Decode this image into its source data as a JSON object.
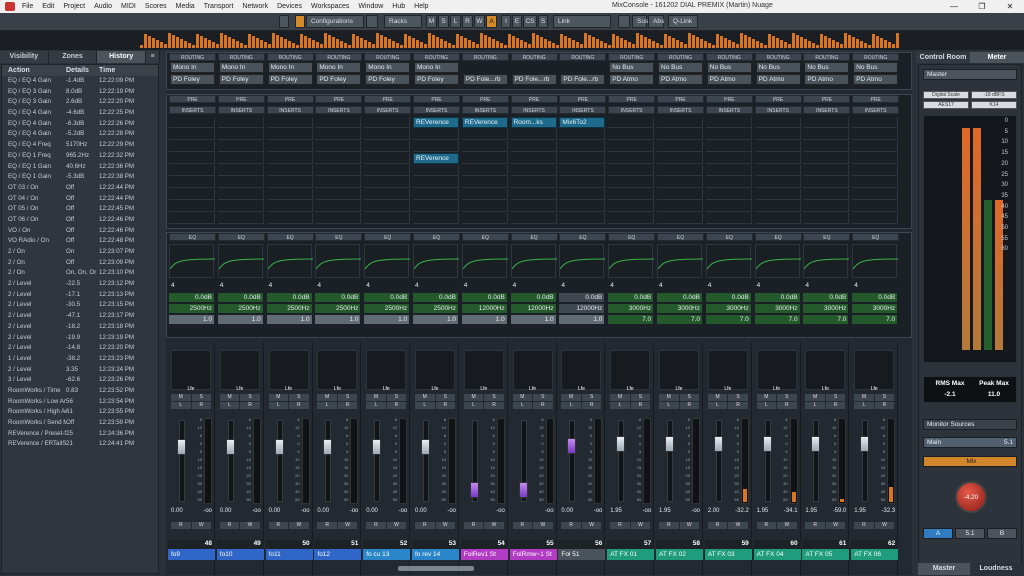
{
  "window": {
    "title": "MixConsole - 161202 DIAL PREMIX (Martin) Nuage",
    "controls": [
      "—",
      "❐",
      "✕"
    ],
    "menu": [
      "File",
      "Edit",
      "Project",
      "Audio",
      "MIDI",
      "Scores",
      "Media",
      "Transport",
      "Network",
      "Devices",
      "Workspaces",
      "Window",
      "Hub",
      "Help"
    ]
  },
  "toolbar": {
    "configurations": "Configurations",
    "racks": "Racks",
    "msrwa": [
      "M",
      "S",
      "L",
      "R",
      "W",
      "A"
    ],
    "iecs": [
      "I",
      "E",
      "CS",
      "S"
    ],
    "link": "Link",
    "sus_abs": [
      "Sus",
      "Abs"
    ],
    "qlink": "Q-Link"
  },
  "left_tabs": [
    "Visibility",
    "Zones",
    "History"
  ],
  "history": {
    "headers": [
      "Action",
      "Details",
      "Time"
    ],
    "rows": [
      [
        "EQ / EQ 4 Gain",
        "-1.4dB",
        "12:22:09 PM"
      ],
      [
        "EQ / EQ 3 Gain",
        "8.0dB",
        "12:22:19 PM"
      ],
      [
        "EQ / EQ 3 Gain",
        "2.6dB",
        "12:22:20 PM"
      ],
      [
        "EQ / EQ 4 Gain",
        "-4.6dB",
        "12:22:25 PM"
      ],
      [
        "EQ / EQ 4 Gain",
        "-6.3dB",
        "12:22:26 PM"
      ],
      [
        "EQ / EQ 4 Gain",
        "-5.2dB",
        "12:22:28 PM"
      ],
      [
        "EQ / EQ 4 Freq",
        "5170Hz",
        "12:22:29 PM"
      ],
      [
        "EQ / EQ 1 Freq",
        "965.2Hz",
        "12:22:32 PM"
      ],
      [
        "EQ / EQ 1 Gain",
        "40.6Hz",
        "12:22:36 PM"
      ],
      [
        "EQ / EQ 1 Gain",
        "-5.3dB",
        "12:22:38 PM"
      ],
      [
        "OT 03 / On",
        "Off",
        "12:22:44 PM"
      ],
      [
        "OT 04 / On",
        "Off",
        "12:22:44 PM"
      ],
      [
        "OT 05 / On",
        "Off",
        "12:22:45 PM"
      ],
      [
        "OT 06 / On",
        "Off",
        "12:22:46 PM"
      ],
      [
        "VO / On",
        "Off",
        "12:22:46 PM"
      ],
      [
        "VO RAdio / On",
        "Off",
        "12:22:48 PM"
      ],
      [
        "2 / On",
        "On",
        "12:23:07 PM"
      ],
      [
        "2 / On",
        "Off",
        "12:23:09 PM"
      ],
      [
        "2 / On",
        "On, On, Or",
        "12:23:10 PM"
      ],
      [
        "2 / Level",
        "-22.5",
        "12:23:12 PM"
      ],
      [
        "2 / Level",
        "-17.1",
        "12:23:13 PM"
      ],
      [
        "2 / Level",
        "-30.5",
        "12:23:15 PM"
      ],
      [
        "2 / Level",
        "-47.1",
        "12:23:17 PM"
      ],
      [
        "2 / Level",
        "-18.2",
        "12:23:18 PM"
      ],
      [
        "2 / Level",
        "-19.9",
        "12:23:19 PM"
      ],
      [
        "2 / Level",
        "-14.8",
        "12:23:20 PM"
      ],
      [
        "1 / Level",
        "-38.2",
        "12:23:23 PM"
      ],
      [
        "2 / Level",
        "3.35",
        "12:23:24 PM"
      ],
      [
        "3 / Level",
        "-62.6",
        "12:23:26 PM"
      ],
      [
        "RoomWorks / Time",
        "0.83",
        "12:23:52 PM"
      ],
      [
        "RoomWorks / Low Amc",
        "56",
        "12:23:54 PM"
      ],
      [
        "RoomWorks / High Am",
        "61",
        "12:23:55 PM"
      ],
      [
        "RoomWorks / Send Mc",
        "Off",
        "12:23:59 PM"
      ],
      [
        "REVerence / Preset-Nr.",
        "25",
        "12:24:36 PM"
      ],
      [
        "REVerence / ERTailSplit",
        "21",
        "12:24:41 PM"
      ]
    ]
  },
  "rack_labels": {
    "routing": "ROUTING",
    "pre": "PRE",
    "inserts": "INSERTS",
    "eq": "EQ"
  },
  "channels": [
    {
      "in": "Mono In",
      "out": "PD Foley",
      "eq_gain": "0.0dB",
      "eq_freq": "2500Hz",
      "eq_q": "1.0",
      "eq_band": "4",
      "pan": "0.00",
      "vol": "-oo",
      "num": "48",
      "name": "fo9",
      "color": "#2f66c8",
      "fader": 0.73,
      "meter": 0,
      "purple": false,
      "insert": ""
    },
    {
      "in": "Mono In",
      "out": "PD Foley",
      "eq_gain": "0.0dB",
      "eq_freq": "2500Hz",
      "eq_q": "1.0",
      "eq_band": "4",
      "pan": "0.00",
      "vol": "-oo",
      "num": "49",
      "name": "fo10",
      "color": "#2f66c8",
      "fader": 0.73,
      "meter": 0,
      "purple": false,
      "insert": ""
    },
    {
      "in": "Mono In",
      "out": "PD Foley",
      "eq_gain": "0.0dB",
      "eq_freq": "2500Hz",
      "eq_q": "1.0",
      "eq_band": "4",
      "pan": "0.00",
      "vol": "-oo",
      "num": "50",
      "name": "fo11",
      "color": "#2f66c8",
      "fader": 0.73,
      "meter": 0,
      "purple": false,
      "insert": ""
    },
    {
      "in": "Mono In",
      "out": "PD Foley",
      "eq_gain": "0.0dB",
      "eq_freq": "2500Hz",
      "eq_q": "1.0",
      "eq_band": "4",
      "pan": "0.00",
      "vol": "-oo",
      "num": "51",
      "name": "fo12",
      "color": "#2f66c8",
      "fader": 0.73,
      "meter": 0,
      "purple": false,
      "insert": ""
    },
    {
      "in": "Mono In",
      "out": "PD Foley",
      "eq_gain": "0.0dB",
      "eq_freq": "2500Hz",
      "eq_q": "1.0",
      "eq_band": "4",
      "pan": "0.00",
      "vol": "-oo",
      "num": "52",
      "name": "fo cu 13",
      "color": "#2a86c8",
      "fader": 0.73,
      "meter": 0,
      "purple": false,
      "insert": ""
    },
    {
      "in": "Mono In",
      "out": "PD Foley",
      "eq_gain": "0.0dB",
      "eq_freq": "2500Hz",
      "eq_q": "1.0",
      "eq_band": "4",
      "pan": "0.00",
      "vol": "-oo",
      "num": "53",
      "name": "fo rev 14",
      "color": "#2a86c8",
      "fader": 0.73,
      "meter": 0,
      "purple": false,
      "insert": "REVerence"
    },
    {
      "in": "",
      "out": "PD Fole...rb",
      "eq_gain": "0.0dB",
      "eq_freq": "12000Hz",
      "eq_q": "1.0",
      "eq_band": "4",
      "pan": "",
      "vol": "-oo",
      "num": "54",
      "name": "FolRev1 St",
      "color": "#b23bc4",
      "fader": 0.12,
      "meter": 0,
      "purple": true,
      "insert": "REVerence"
    },
    {
      "in": "",
      "out": "PD Fole...rb",
      "eq_gain": "0.0dB",
      "eq_freq": "12000Hz",
      "eq_q": "1.0",
      "eq_band": "4",
      "pan": "",
      "vol": "-oo",
      "num": "55",
      "name": "FolRmw~1 St",
      "color": "#b23bc4",
      "fader": 0.12,
      "meter": 0,
      "purple": true,
      "insert": "Room...ks"
    },
    {
      "in": "",
      "out": "PD Fole...rb",
      "eq_gain": "0.0dB",
      "eq_freq": "12000Hz",
      "eq_q": "1.0",
      "eq_band": "4",
      "pan": "0.00",
      "vol": "-oo",
      "num": "56",
      "name": "Fol 51",
      "color": "#4a525c",
      "fader": 0.75,
      "meter": 0,
      "purple": true,
      "insert": "Mix6To2"
    },
    {
      "in": "No Bus",
      "out": "PD Atmo",
      "eq_gain": "0.0dB",
      "eq_freq": "3000Hz",
      "eq_q": "7.0",
      "eq_band": "4",
      "pan": "1.95",
      "vol": "-oo",
      "num": "57",
      "name": "AT FX 01",
      "color": "#1f9c7c",
      "fader": 0.77,
      "meter": 0,
      "purple": false,
      "insert": ""
    },
    {
      "in": "No Bus",
      "out": "PD Atmo",
      "eq_gain": "0.0dB",
      "eq_freq": "3000Hz",
      "eq_q": "7.0",
      "eq_band": "4",
      "pan": "1.95",
      "vol": "-oo",
      "num": "58",
      "name": "AT FX 02",
      "color": "#1f9c7c",
      "fader": 0.77,
      "meter": 0,
      "purple": false,
      "insert": ""
    },
    {
      "in": "No Bus",
      "out": "PD Atmo",
      "eq_gain": "0.0dB",
      "eq_freq": "3000Hz",
      "eq_q": "7.0",
      "eq_band": "4",
      "pan": "2.00",
      "vol": "-32.2",
      "num": "59",
      "name": "AT FX 03",
      "color": "#1f9c7c",
      "fader": 0.77,
      "meter": 0.15,
      "purple": false,
      "insert": ""
    },
    {
      "in": "No Bus",
      "out": "PD Atmo",
      "eq_gain": "0.0dB",
      "eq_freq": "3000Hz",
      "eq_q": "7.0",
      "eq_band": "4",
      "pan": "1.95",
      "vol": "-34.1",
      "num": "60",
      "name": "AT FX 04",
      "color": "#1f9c7c",
      "fader": 0.77,
      "meter": 0.12,
      "purple": false,
      "insert": ""
    },
    {
      "in": "No Bus",
      "out": "PD Atmo",
      "eq_gain": "0.0dB",
      "eq_freq": "3000Hz",
      "eq_q": "7.0",
      "eq_band": "4",
      "pan": "1.95",
      "vol": "-59.0",
      "num": "61",
      "name": "AT FX 05",
      "color": "#1f9c7c",
      "fader": 0.77,
      "meter": 0.04,
      "purple": false,
      "insert": ""
    },
    {
      "in": "No Bus",
      "out": "PD Atmo",
      "eq_gain": "0.0dB",
      "eq_freq": "3000Hz",
      "eq_q": "7.0",
      "eq_band": "4",
      "pan": "1.95",
      "vol": "-32.3",
      "num": "62",
      "name": "AT FX 06",
      "color": "#1f9c7c",
      "fader": 0.77,
      "meter": 0.18,
      "purple": false,
      "insert": ""
    }
  ],
  "extra_insert": "REVerence",
  "lfe_label": "Lfe",
  "btn_ms": [
    "M",
    "S"
  ],
  "btn_lr": [
    "L",
    "R"
  ],
  "btn_rw": [
    "R",
    "W"
  ],
  "fader_scale": [
    "6",
    "12",
    "6",
    "0",
    "5",
    "10",
    "15",
    "20",
    "30",
    "40",
    "50",
    "60",
    "80"
  ],
  "control_room": {
    "tabs": [
      "Control Room",
      "Meter"
    ],
    "master": "Master",
    "digital_scale": "Digital Scale",
    "scale_value": "-18 dBFS",
    "aes": "AES17",
    "k14": "K14",
    "meter_scale": [
      "0",
      "5",
      "10",
      "15",
      "20",
      "25",
      "30",
      "35",
      "40",
      "45",
      "50",
      "55",
      "60"
    ],
    "rms_label": "RMS Max",
    "rms_value": "-2.1",
    "peak_label": "Peak Max",
    "peak_value": "11.0",
    "monitor_sources": "Monitor Sources",
    "main": "Main",
    "main_fmt": "5.1",
    "mix": "Mix",
    "knob_value": "-4.20",
    "ab": [
      "A",
      "5.1",
      "B"
    ],
    "bottom_tabs": [
      "Master",
      "Loudness"
    ]
  }
}
